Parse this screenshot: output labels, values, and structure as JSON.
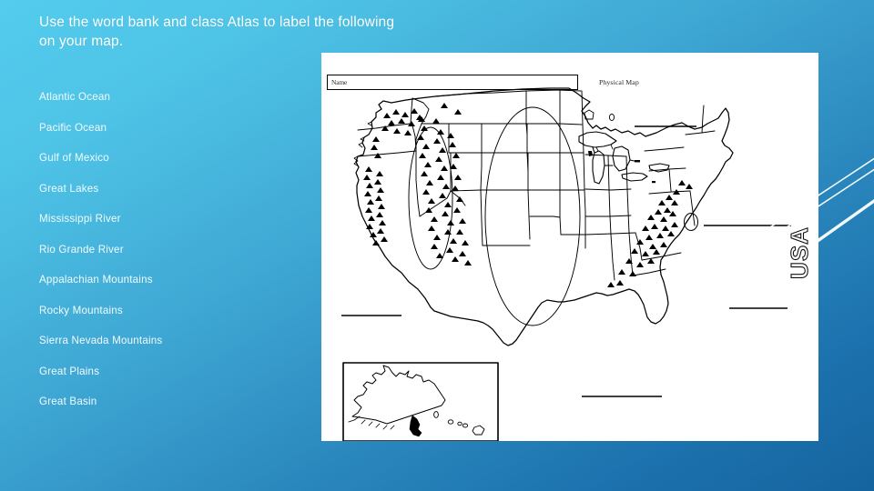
{
  "slide": {
    "background_top_color": "#53ccee",
    "background_bottom_color": "#15649f",
    "accent_color": "#ffffff"
  },
  "title": {
    "line1": "Use the word bank and class Atlas to label the following",
    "line2": "on your map."
  },
  "word_bank": {
    "items": [
      "Atlantic Ocean",
      "Pacific Ocean",
      "Gulf of Mexico",
      "Great Lakes",
      "Mississippi River",
      "Rio Grande River",
      "Appalachian Mountains",
      "Rocky Mountains",
      "Sierra Nevada Mountains",
      "Great Plains",
      "Great Basin"
    ]
  },
  "worksheet": {
    "name_field_label": "Name",
    "name_field_value": "",
    "map_title": "Physical Map",
    "map_caption": "USA",
    "map_type": "blank United States physical outline map",
    "inset_label": "Alaska and Hawaii inset",
    "blank_label_lines": [
      {
        "id": "pacific-ocean-line",
        "hint": "Pacific Ocean"
      },
      {
        "id": "great-lakes-line",
        "hint": "Great Lakes"
      },
      {
        "id": "atlantic-ocean-line",
        "hint": "Atlantic Ocean"
      },
      {
        "id": "atlantic-ocean-line-2",
        "hint": "Atlantic Ocean"
      },
      {
        "id": "gulf-of-mexico-line",
        "hint": "Gulf of Mexico"
      }
    ],
    "map_symbols": [
      {
        "id": "rocky-mountains-symbols",
        "symbol": "triangles"
      },
      {
        "id": "sierra-nevada-symbols",
        "symbol": "triangles"
      },
      {
        "id": "appalachian-symbols",
        "symbol": "triangles"
      },
      {
        "id": "great-basin-ellipse",
        "symbol": "ellipse"
      },
      {
        "id": "great-plains-ellipse",
        "symbol": "ellipse"
      }
    ]
  }
}
